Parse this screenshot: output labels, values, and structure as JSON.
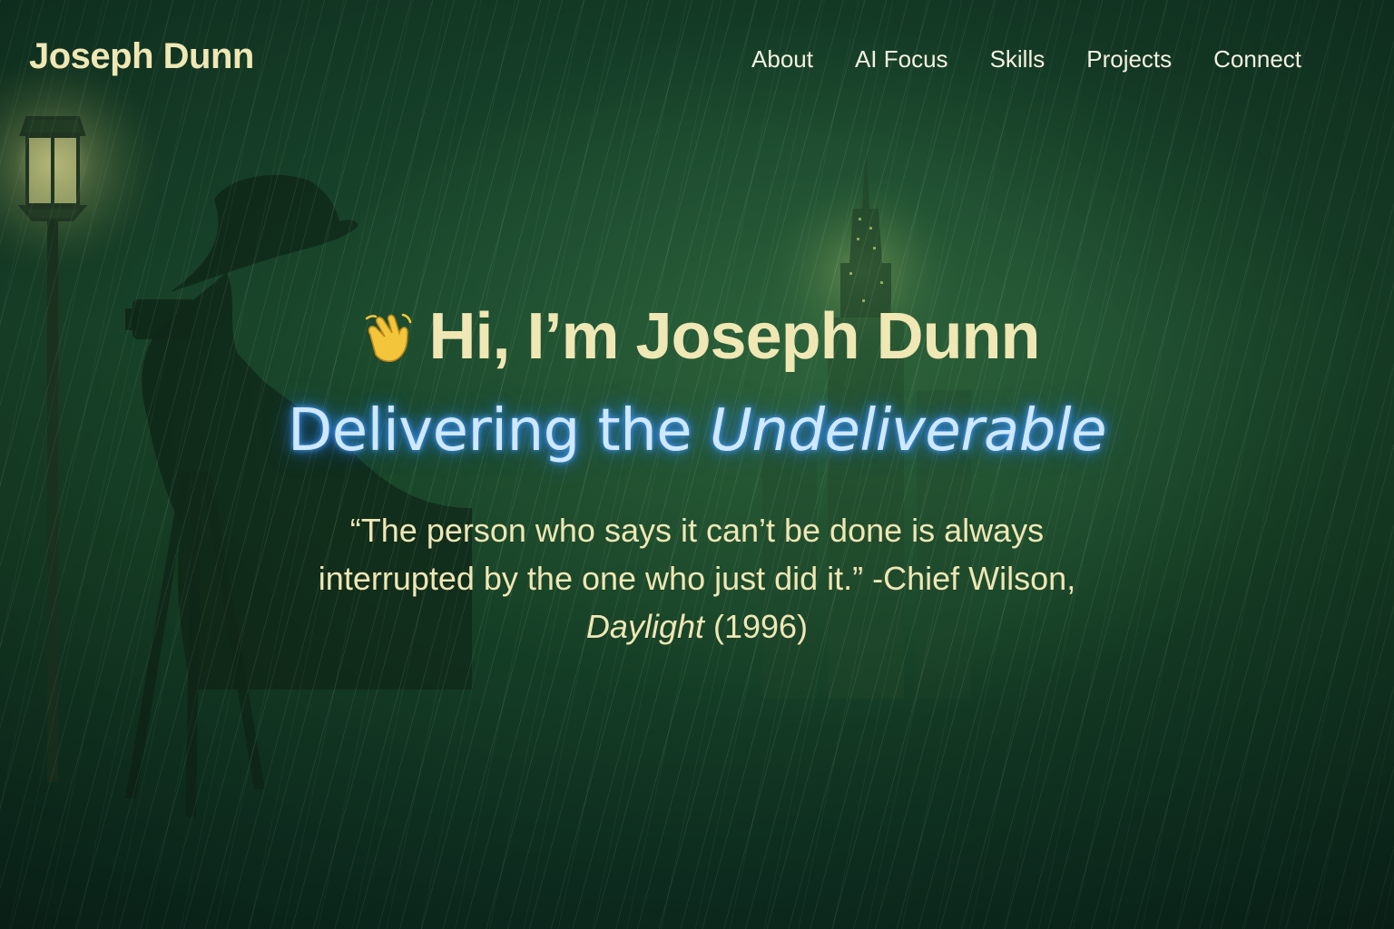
{
  "brand": "Joseph Dunn",
  "nav": {
    "items": [
      {
        "label": "About"
      },
      {
        "label": "AI Focus"
      },
      {
        "label": "Skills"
      },
      {
        "label": "Projects"
      },
      {
        "label": "Connect"
      }
    ]
  },
  "hero": {
    "wave_icon": "waving-hand-icon",
    "headline": "Hi, I’m Joseph Dunn",
    "tagline_part1": "Delivering the ",
    "tagline_part2": "Undeliverable",
    "quote_text": "“The person who says it can’t be done is always interrupted by the one who just did it.” -Chief Wilson, ",
    "quote_film": "Daylight",
    "quote_year": " (1996)"
  },
  "colors": {
    "background": "#174227",
    "heading": "#efe7b4",
    "nav_text": "#f4f1e2",
    "neon": "#3a8cff"
  }
}
